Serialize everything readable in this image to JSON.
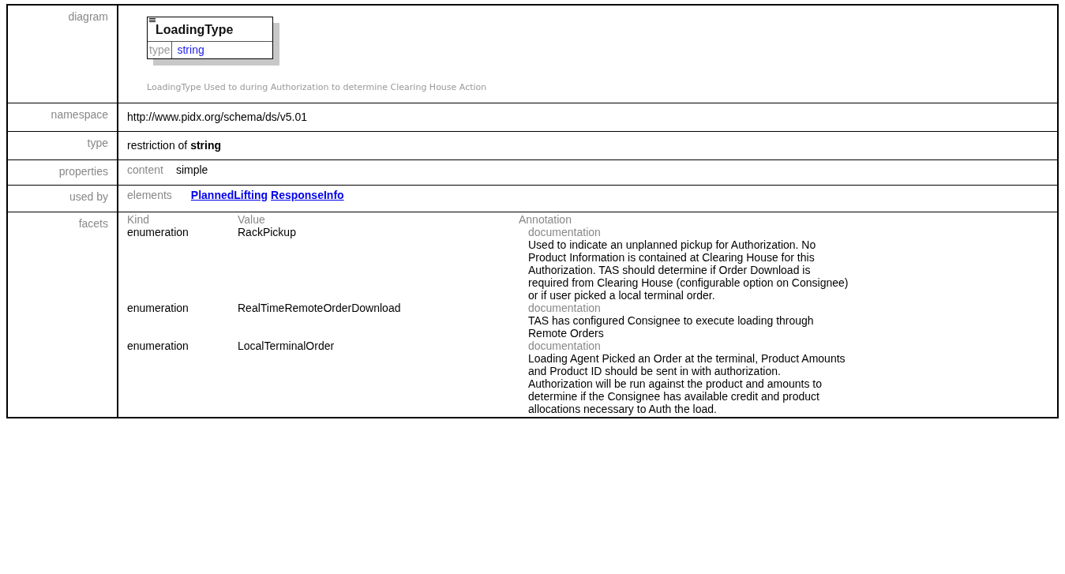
{
  "rows": [
    {
      "kind": "diagram",
      "label": "diagram",
      "diagram": {
        "name": "LoadingType",
        "type_label": "type",
        "type_value": "string"
      },
      "caption": "LoadingType Used to during Authorization to determine Clearing House Action"
    },
    {
      "kind": "text",
      "label": "namespace",
      "value": "http://www.pidx.org/schema/ds/v5.01"
    },
    {
      "kind": "text",
      "label": "type",
      "value": "restriction of **string**"
    },
    {
      "kind": "props",
      "label": "properties",
      "props": [
        {
          "name": "content",
          "value": "simple"
        }
      ]
    },
    {
      "kind": "usedby",
      "label": "used by",
      "category": "elements",
      "links": [
        "PlannedLifting",
        "ResponseInfo"
      ]
    },
    {
      "kind": "facets",
      "label": "facets",
      "columns": [
        "Kind",
        "Value",
        "Annotation"
      ],
      "facets": [
        {
          "kind": "enumeration",
          "value": "RackPickup",
          "doc_label": "documentation",
          "doc": "Used to indicate an unplanned pickup for Authorization.  No\nProduct Information is contained at Clearing House for this\nAuthorization.  TAS should determine if Order Download is\nrequired from Clearing House (configurable option on Consignee)\nor if user picked a local terminal order."
        },
        {
          "kind": "enumeration",
          "value": "RealTimeRemoteOrderDownload",
          "doc_label": "documentation",
          "doc": "TAS has configured Consignee to execute loading through\nRemote Orders"
        },
        {
          "kind": "enumeration",
          "value": "LocalTerminalOrder",
          "doc_label": "documentation",
          "doc": "Loading Agent Picked an Order at the terminal, Product Amounts\nand Product ID should be sent in with authorization.\nAuthorization will be run against the product and amounts to\ndetermine if the Consignee has available credit and product\nallocations necessary to Auth the load."
        }
      ]
    }
  ]
}
